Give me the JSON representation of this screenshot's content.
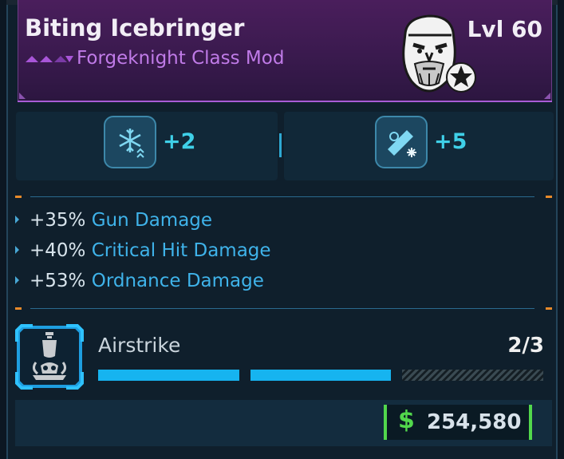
{
  "item": {
    "name": "Biting Icebringer",
    "level": "Lvl 60",
    "type": "Forgeknight Class Mod",
    "rarity_color": "#a855d8",
    "portrait_icon": "bearded-warrior-portrait-icon",
    "class_badge_icon": "star-badge-icon"
  },
  "skill_boosts": [
    {
      "icon": "snowflake-skill-icon",
      "value": "+2"
    },
    {
      "icon": "cryo-weapon-skill-icon",
      "value": "+5"
    }
  ],
  "stats": [
    {
      "amount": "+35%",
      "label": "Gun Damage"
    },
    {
      "amount": "+40%",
      "label": "Critical Hit Damage"
    },
    {
      "amount": "+53%",
      "label": "Ordnance Damage"
    }
  ],
  "skill": {
    "icon": "airstrike-skull-icon",
    "name": "Airstrike",
    "points": "2/3",
    "filled": 2,
    "total": 3
  },
  "price": {
    "currency_icon": "dollar-icon",
    "currency_symbol": "$",
    "amount": "254,580",
    "color": "#52d84c"
  },
  "colors": {
    "accent": "#3fb3ea",
    "purple": "#c07be8",
    "orange": "#e88a2a"
  }
}
